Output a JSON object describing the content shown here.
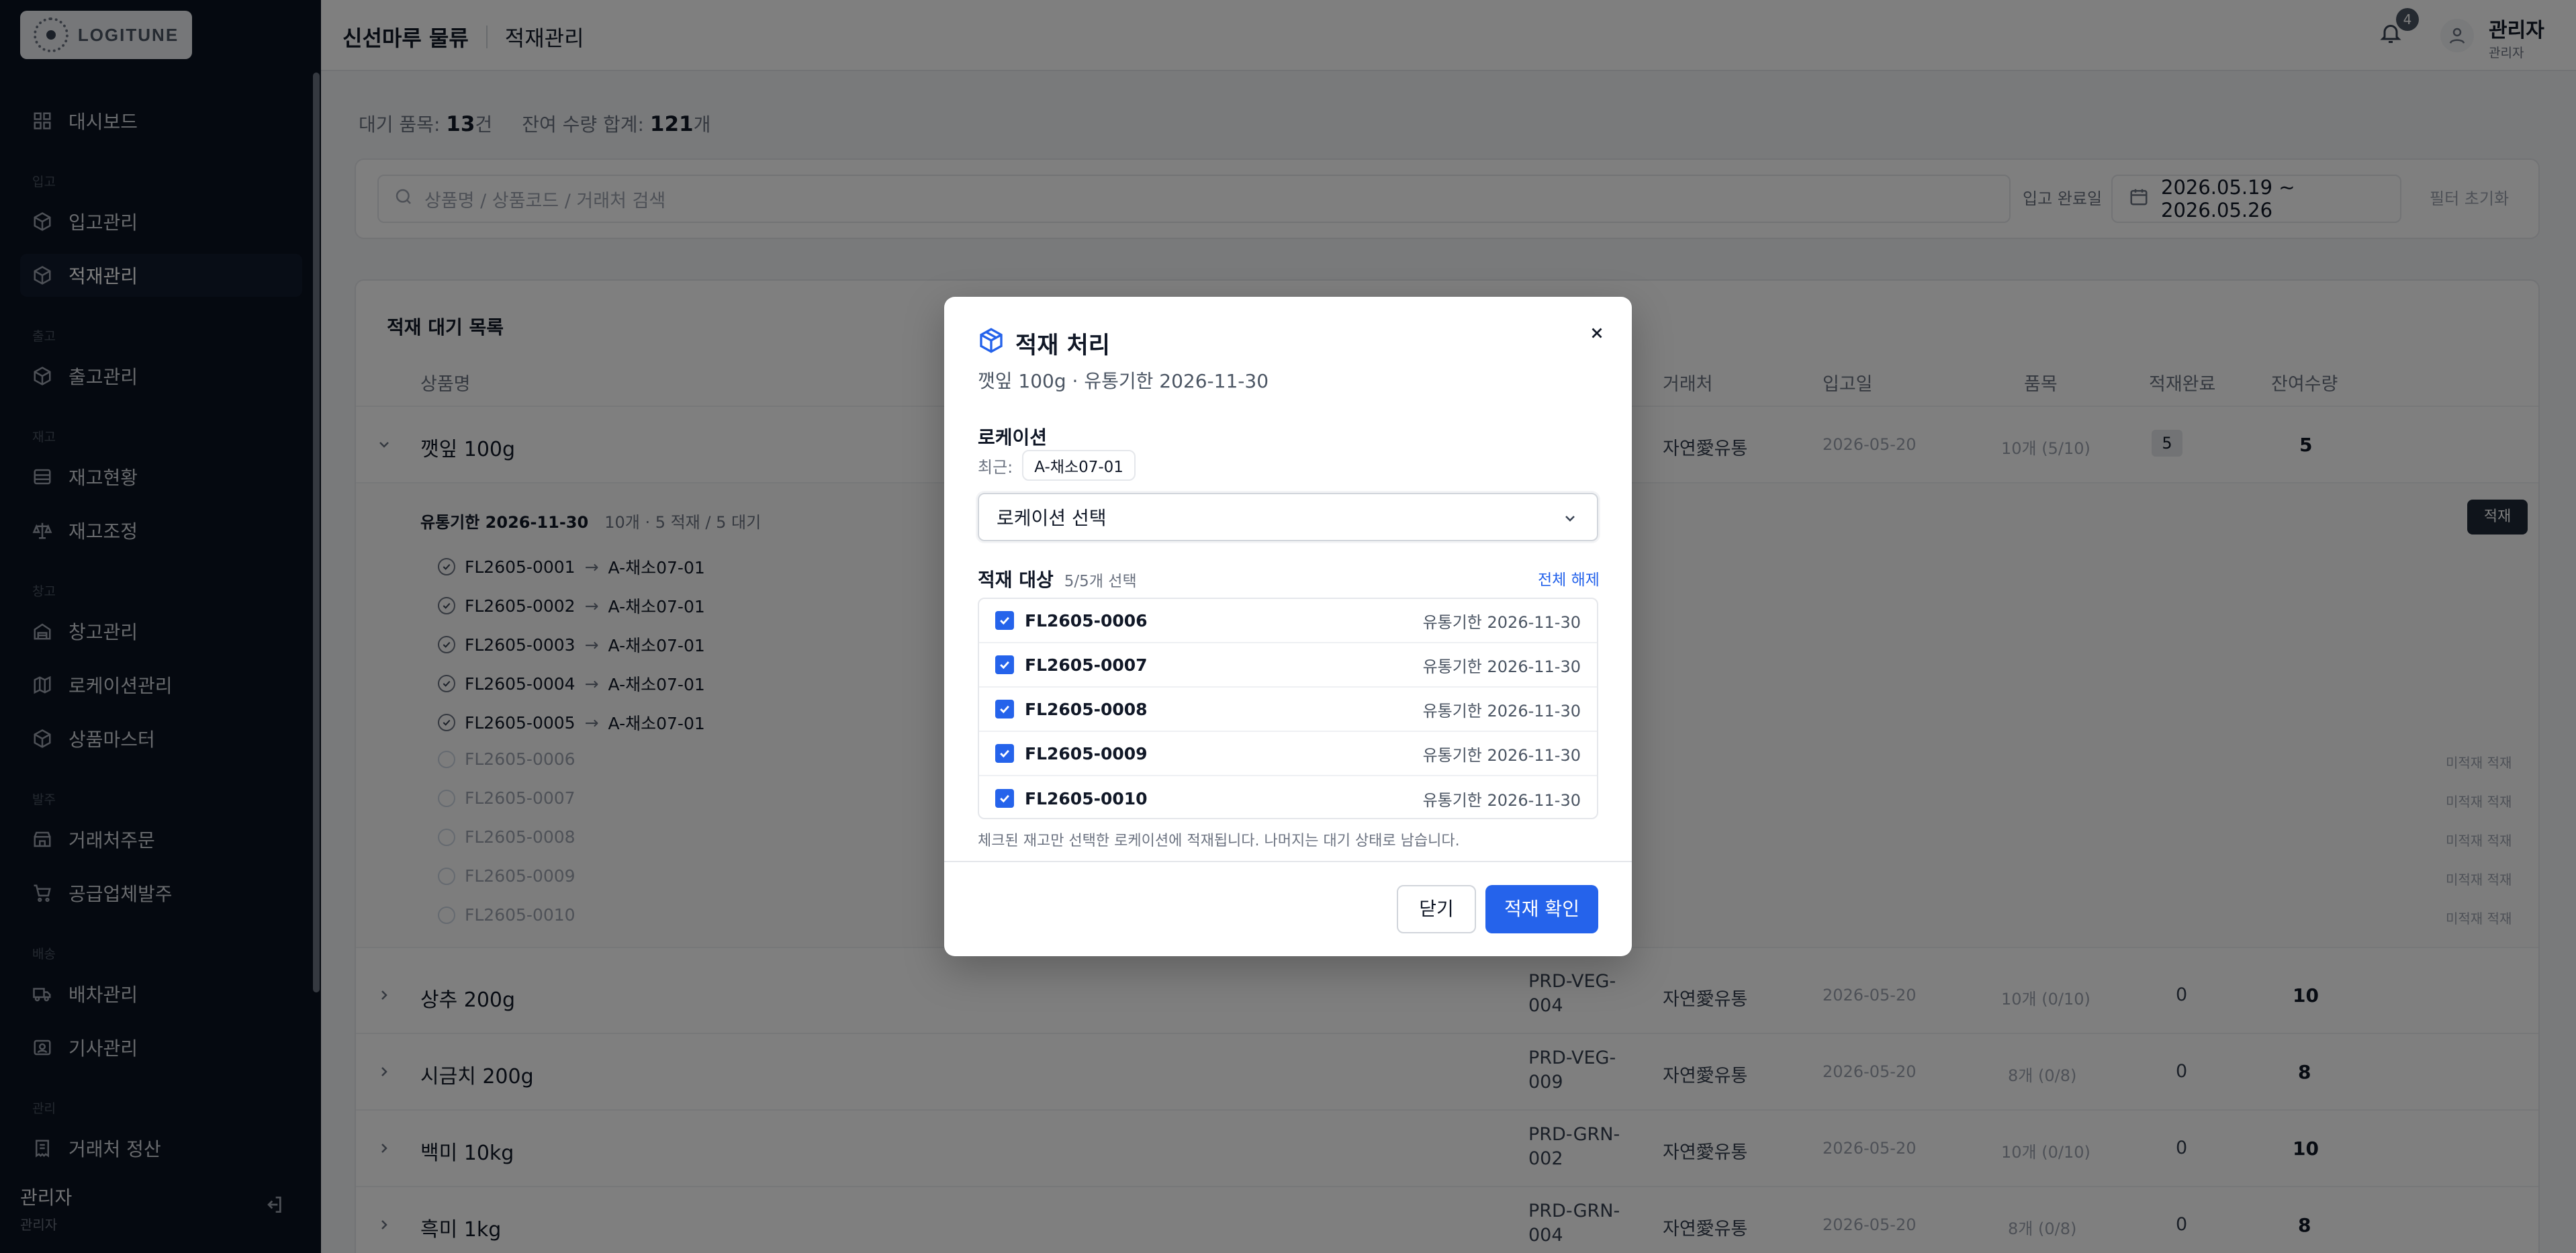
{
  "brand": {
    "logo_text": "LOGITUNE"
  },
  "sidebar": {
    "sections": [
      "입고",
      "출고",
      "재고",
      "창고",
      "발주",
      "배송",
      "관리"
    ],
    "items": [
      {
        "label": "대시보드",
        "icon": "grid-icon"
      },
      {
        "label": "입고관리",
        "icon": "box-icon"
      },
      {
        "label": "적재관리",
        "icon": "box-icon"
      },
      {
        "label": "출고관리",
        "icon": "box-icon"
      },
      {
        "label": "재고현황",
        "icon": "layers-icon"
      },
      {
        "label": "재고조정",
        "icon": "scale-icon"
      },
      {
        "label": "창고관리",
        "icon": "warehouse-icon"
      },
      {
        "label": "로케이션관리",
        "icon": "map-icon"
      },
      {
        "label": "상품마스터",
        "icon": "box-icon"
      },
      {
        "label": "거래처주문",
        "icon": "store-icon"
      },
      {
        "label": "공급업체발주",
        "icon": "cart-icon"
      },
      {
        "label": "배차관리",
        "icon": "truck-icon"
      },
      {
        "label": "기사관리",
        "icon": "id-card-icon"
      },
      {
        "label": "거래처 정산",
        "icon": "receipt-icon"
      }
    ],
    "user": {
      "name": "관리자",
      "role": "관리자"
    }
  },
  "header": {
    "company": "신선마루 물류",
    "section": "적재관리",
    "notification_count": "4",
    "user_name": "관리자",
    "user_role": "관리자"
  },
  "stats": {
    "pending_label": "대기 품목:",
    "pending_value": "13",
    "pending_unit": "건",
    "remain_label": "잔여 수량 합계:",
    "remain_value": "121",
    "remain_unit": "개"
  },
  "filters": {
    "search_placeholder": "상품명 / 상품코드 / 거래처 검색",
    "date_label": "입고 완료일",
    "date_range": "2026.05.19 ~ 2026.05.26",
    "reset_label": "필터 초기화"
  },
  "list": {
    "title": "적재 대기 목록",
    "columns": [
      "상품명",
      "거래처",
      "입고일",
      "품목",
      "적재완료",
      "잔여수량"
    ],
    "expanded_row": {
      "name": "깻잎 100g",
      "partner": "자연愛유통",
      "date": "2026-05-20",
      "items": "10개 (5/10)",
      "done": "5",
      "remain": "5",
      "group_title": "유통기한 2026-11-30",
      "group_meta": "10개 · 5 적재 / 5 대기",
      "group_button": "적재",
      "loaded": [
        {
          "code": "FL2605-0001",
          "loc": "A-채소07-01"
        },
        {
          "code": "FL2605-0002",
          "loc": "A-채소07-01"
        },
        {
          "code": "FL2605-0003",
          "loc": "A-채소07-01"
        },
        {
          "code": "FL2605-0004",
          "loc": "A-채소07-01"
        },
        {
          "code": "FL2605-0005",
          "loc": "A-채소07-01"
        }
      ],
      "pending": [
        "FL2605-0006",
        "FL2605-0007",
        "FL2605-0008",
        "FL2605-0009",
        "FL2605-0010"
      ],
      "pending_tag": "미적재 적재"
    },
    "rows": [
      {
        "name": "상추 200g",
        "code1": "PRD-VEG-",
        "code2": "004",
        "partner": "자연愛유통",
        "date": "2026-05-20",
        "items": "10개 (0/10)",
        "done": "0",
        "remain": "10"
      },
      {
        "name": "시금치 200g",
        "code1": "PRD-VEG-",
        "code2": "009",
        "partner": "자연愛유통",
        "date": "2026-05-20",
        "items": "8개 (0/8)",
        "done": "0",
        "remain": "8"
      },
      {
        "name": "백미 10kg",
        "code1": "PRD-GRN-",
        "code2": "002",
        "partner": "자연愛유통",
        "date": "2026-05-20",
        "items": "10개 (0/10)",
        "done": "0",
        "remain": "10"
      },
      {
        "name": "흑미 1kg",
        "code1": "PRD-GRN-",
        "code2": "004",
        "partner": "자연愛유통",
        "date": "2026-05-20",
        "items": "8개 (0/8)",
        "done": "0",
        "remain": "8"
      }
    ]
  },
  "modal": {
    "title": "적재 처리",
    "subtitle": "깻잎 100g · 유통기한 2026-11-30",
    "location_label": "로케이션",
    "recent_label": "최근:",
    "recent_chip": "A-채소07-01",
    "select_placeholder": "로케이션 선택",
    "target_label": "적재 대상",
    "target_count": "5/5개 선택",
    "clear_all": "전체 해제",
    "rows": [
      {
        "code": "FL2605-0006",
        "expiry": "유통기한 2026-11-30"
      },
      {
        "code": "FL2605-0007",
        "expiry": "유통기한 2026-11-30"
      },
      {
        "code": "FL2605-0008",
        "expiry": "유통기한 2026-11-30"
      },
      {
        "code": "FL2605-0009",
        "expiry": "유통기한 2026-11-30"
      },
      {
        "code": "FL2605-0010",
        "expiry": "유통기한 2026-11-30"
      }
    ],
    "note": "체크된 재고만 선택한 로케이션에 적재됩니다. 나머지는 대기 상태로 남습니다.",
    "close_label": "닫기",
    "confirm_label": "적재 확인"
  },
  "colors": {
    "accent": "#2563eb",
    "sidebar_bg": "#0b1220"
  }
}
